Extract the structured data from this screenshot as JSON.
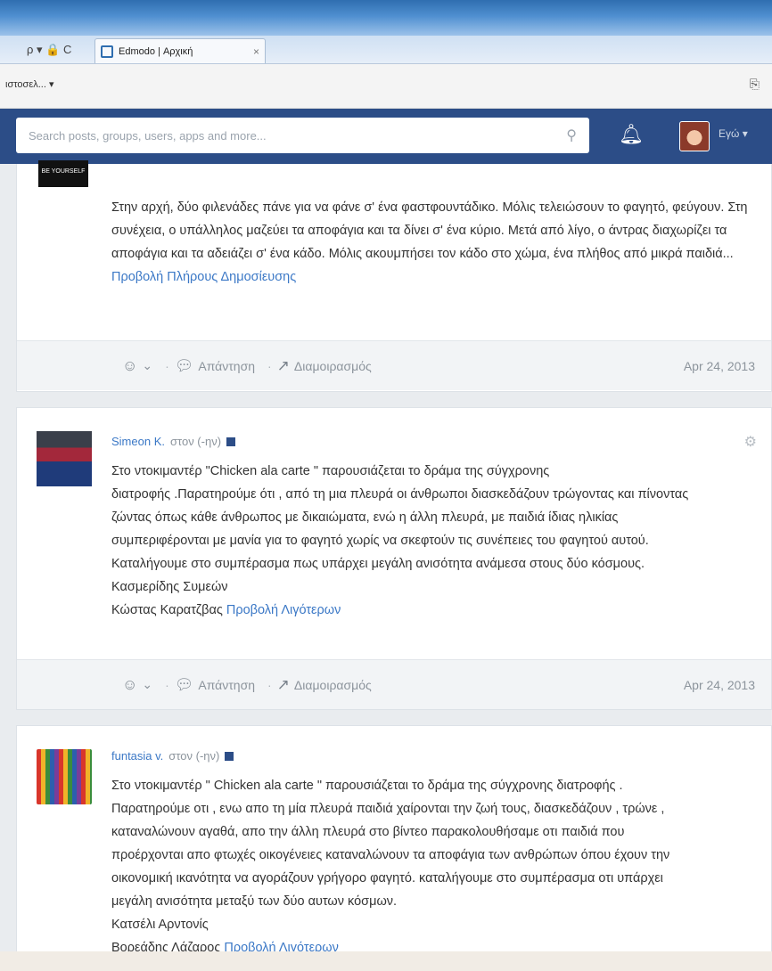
{
  "browser": {
    "addr_tools": "ρ ▾ 🔒 C",
    "tab_title": "Edmodo | Αρχική",
    "tab_close": "×",
    "menu_label": "ιστοσελ... ▾"
  },
  "header": {
    "search_placeholder": "Search posts, groups, users, apps and more...",
    "me_label": "Εγώ ▾"
  },
  "posts": [
    {
      "thumb_text": "BE YOURSELF",
      "text": "Στην αρχή, δύο φιλενάδες πάνε για να φάνε σ' ένα φαστφουντάδικο. Μόλις τελειώσουν το φαγητό, φεύγουν. Στη συνέχεια, ο υπάλληλος μαζεύει τα αποφάγια και τα δίνει σ' ένα κύριο. Μετά από λίγο, ο άντρας διαχωρίζει τα αποφάγια και τα αδειάζει σ' ένα κάδο. Μόλις ακουμπήσει τον κάδο στο χώμα, ένα πλήθος από μικρά παιδιά...",
      "link": "Προβολή Πλήρους Δημοσίευσης",
      "reply": "Απάντηση",
      "share": "Διαμοιρασμός",
      "date": "Apr 24, 2013"
    },
    {
      "author": "Simeon K.",
      "target": "στον (-ην)",
      "lines": [
        "Στο ντοκιμαντέρ \"Chicken ala carte \" παρουσιάζεται το δράμα της σύγχρονης",
        "διατροφής .Παρατηρούμε ότι , από τη μια πλευρά οι άνθρωποι διασκεδάζουν τρώγοντας και πίνοντας",
        "ζώντας όπως κάθε άνθρωπος με δικαιώματα, ενώ η άλλη πλευρά, με παιδιά ίδιας ηλικίας",
        "συμπεριφέρονται με μανία για το φαγητό χωρίς να σκεφτούν τις συνέπειες του φαγητού αυτού.",
        "Καταλήγουμε στο συμπέρασμα πως υπάρχει μεγάλη ανισότητα ανάμεσα στους δύο κόσμους.",
        "Κασμερίδης Συμεών",
        "Κώστας Καρατζβας"
      ],
      "link": "Προβολή Λιγότερων",
      "reply": "Απάντηση",
      "share": "Διαμοιρασμός",
      "date": "Apr 24, 2013"
    },
    {
      "author": "funtasia v.",
      "target": "στον (-ην)",
      "lines": [
        "Στο ντοκιμαντέρ \" Chicken ala carte \" παρουσιάζεται το δράμα της σύγχρονης διατροφής .",
        "Παρατηρούμε οτι , ενω απο τη μία πλευρά παιδιά χαίρονται την ζωή τους, διασκεδάζουν , τρώνε ,",
        "καταναλώνουν αγαθά, απο την άλλη πλευρά στο βίντεο παρακολουθήσαμε οτι παιδιά που",
        "προέρχονται απο φτωχές οικογένειες καταναλώνουν τα αποφάγια των ανθρώπων όπου έχουν την",
        "οικονομική ικανότητα να αγοράζουν γρήγορο φαγητό. καταλήγουμε στο συμπέρασμα οτι υπάρχει",
        "μεγάλη ανισότητα μεταξύ των δύο αυτων κόσμων.",
        "Κατσέλι Αρντονίς",
        "Βορεάδης Λάζαρος"
      ],
      "link": "Προβολή Λιγότερων"
    }
  ]
}
